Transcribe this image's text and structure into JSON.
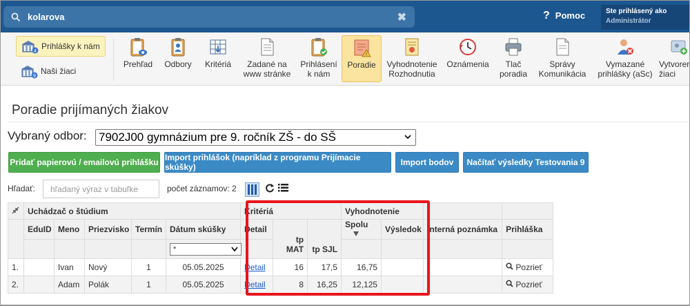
{
  "search": {
    "value": "kolarova"
  },
  "header": {
    "help_label": "Pomoc",
    "user_line1": "Ste prihlásený ako",
    "user_line2": "Administrátor"
  },
  "leftnav": [
    {
      "label": "Prihlášky k nám",
      "active": true
    },
    {
      "label": "Naši žiaci",
      "active": false
    }
  ],
  "toolbar": [
    {
      "key": "prehlad",
      "label": "Prehľad"
    },
    {
      "key": "odbory",
      "label": "Odbory"
    },
    {
      "key": "kriteria",
      "label": "Kritériá"
    },
    {
      "key": "zadane",
      "label": "Zadané na\nwww stránke"
    },
    {
      "key": "prihlaseni",
      "label": "Prihlásení\nk nám"
    },
    {
      "key": "poradie",
      "label": "Poradie"
    },
    {
      "key": "vyhodnotenie",
      "label": "Vyhodnotenie\nRozhodnutia"
    },
    {
      "key": "oznamenia",
      "label": "Oznámenia"
    },
    {
      "key": "tlac",
      "label": "Tlač\nporadia"
    },
    {
      "key": "spravy",
      "label": "Správy\nKomunikácia"
    },
    {
      "key": "vymazane",
      "label": "Vymazané\nprihlášky (aSc)"
    },
    {
      "key": "vytvorene",
      "label": "Vytvorené\nžiaci"
    }
  ],
  "page": {
    "title": "Poradie prijímaných žiakov",
    "odbor_label": "Vybraný odbor:",
    "odbor_value": "7902J00 gymnázium pre 9. ročník ZŠ - do SŠ"
  },
  "buttons": {
    "add": "Pridať papierovú / emailovú prihlášku",
    "import": "Import prihlášok (napríklad z programu Prijímacie skúšky)",
    "import_body": "Import bodov",
    "testovanie": "Načítať výsledky Testovania 9"
  },
  "filter": {
    "label": "Hľadať:",
    "placeholder": "hľadaný výraz v tabuľke",
    "count_label": "počet záznamov: 2"
  },
  "table": {
    "group_uchadzac": "Uchádzač o štúdium",
    "group_kriteria": "Kritériá",
    "group_vyhodnotenie": "Vyhodnotenie",
    "headers": {
      "eduid": "EduID",
      "meno": "Meno",
      "priezvisko": "Priezvisko",
      "termin": "Termín",
      "datum": "Dátum skúšky",
      "detail": "Detail",
      "tp_mat": "tp MAT",
      "tp_sjl": "tp SJL",
      "spolu": "Spolu",
      "vysledok": "Výsledok",
      "poznamka": "Interná poznámka",
      "prihlaska": "Prihláška"
    },
    "datum_filter": "*",
    "rows": [
      {
        "n": "1.",
        "eduid": "",
        "meno": "Ivan",
        "priezvisko": "Nový",
        "termin": "1",
        "datum": "05.05.2025",
        "detail": "Detail",
        "tp_mat": "16",
        "tp_sjl": "17,5",
        "spolu": "16,75",
        "vysledok": "",
        "poznamka": "",
        "prihlaska": "Pozrieť"
      },
      {
        "n": "2.",
        "eduid": "",
        "meno": "Adam",
        "priezvisko": "Polák",
        "termin": "1",
        "datum": "05.05.2025",
        "detail": "Detail",
        "tp_mat": "8",
        "tp_sjl": "16,25",
        "spolu": "12,125",
        "vysledok": "",
        "poznamka": "",
        "prihlaska": "Pozrieť"
      }
    ]
  },
  "colors": {
    "topbar": "#1c5790",
    "highlight": "#e8141c",
    "green_btn": "#4fae4f",
    "blue_btn": "#3b8ac6"
  }
}
